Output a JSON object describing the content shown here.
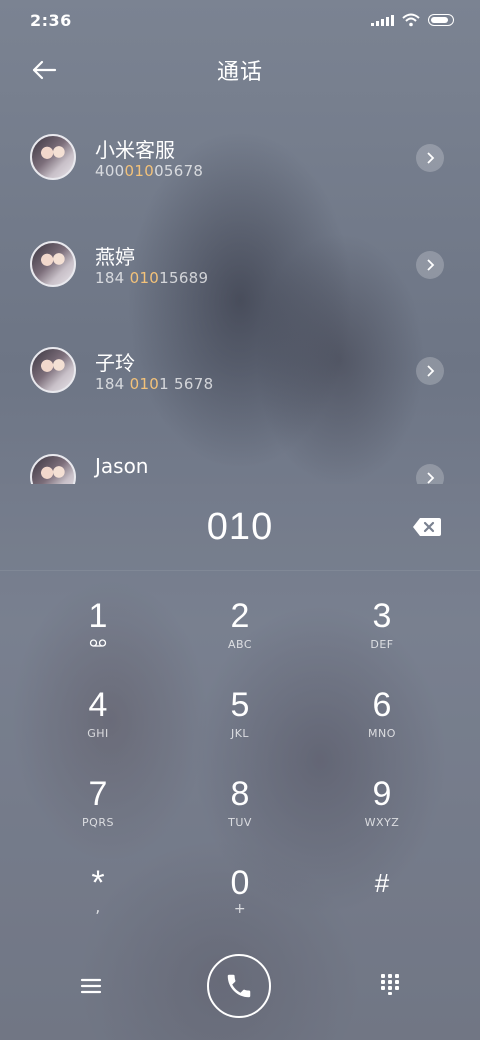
{
  "status_bar": {
    "time": "2:36"
  },
  "header": {
    "title": "通话"
  },
  "contacts": [
    {
      "name": "小米客服",
      "number_parts": [
        "400",
        "010",
        "05678"
      ]
    },
    {
      "name": "燕婷",
      "number_parts": [
        "184 ",
        "010",
        "15689"
      ]
    },
    {
      "name": "子玲",
      "number_parts": [
        "184 ",
        "010",
        "1 5678"
      ]
    },
    {
      "name": "Jason",
      "number_parts": [
        "",
        "",
        ""
      ]
    }
  ],
  "dialpad": {
    "entered_number": "010",
    "keys": [
      {
        "digit": "1",
        "letters": ""
      },
      {
        "digit": "2",
        "letters": "ABC"
      },
      {
        "digit": "3",
        "letters": "DEF"
      },
      {
        "digit": "4",
        "letters": "GHI"
      },
      {
        "digit": "5",
        "letters": "JKL"
      },
      {
        "digit": "6",
        "letters": "MNO"
      },
      {
        "digit": "7",
        "letters": "PQRS"
      },
      {
        "digit": "8",
        "letters": "TUV"
      },
      {
        "digit": "9",
        "letters": "WXYZ"
      },
      {
        "digit": "*",
        "letters": ","
      },
      {
        "digit": "0",
        "letters": "+"
      },
      {
        "digit": "#",
        "letters": ""
      }
    ]
  },
  "colors": {
    "highlight": "#f3c27a"
  },
  "icons": [
    "signal-icon",
    "wifi-icon",
    "battery-icon",
    "back-arrow-icon",
    "chevron-right-icon",
    "backspace-icon",
    "voicemail-icon",
    "menu-icon",
    "phone-icon",
    "dialpad-grid-icon"
  ]
}
